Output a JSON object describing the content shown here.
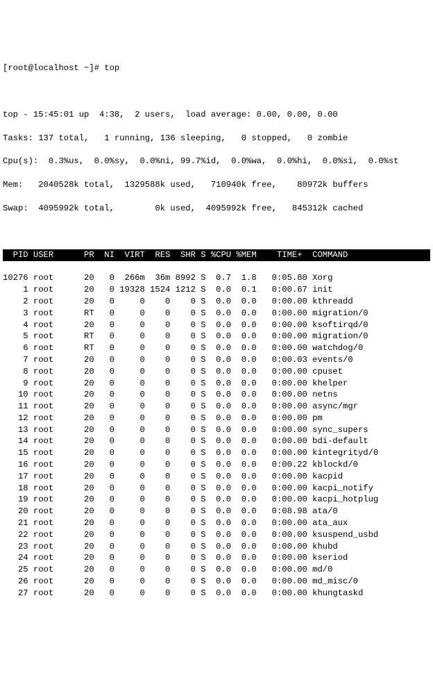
{
  "prompt": "[root@localhost ~]# top",
  "summary": {
    "line1": "top - 15:45:01 up  4:38,  2 users,  load average: 0.00, 0.00, 0.00",
    "line2": "Tasks: 137 total,   1 running, 136 sleeping,   0 stopped,   0 zombie",
    "line3": "Cpu(s):  0.3%us,  0.0%sy,  0.0%ni, 99.7%id,  0.0%wa,  0.0%hi,  0.0%si,  0.0%st",
    "line4": "Mem:   2040528k total,  1329588k used,   710940k free,    80972k buffers",
    "line5": "Swap:  4095992k total,        0k used,  4095992k free,   845312k cached"
  },
  "columns": "  PID USER      PR  NI  VIRT  RES  SHR S %CPU %MEM    TIME+  COMMAND            ",
  "processes": [
    {
      "pid": "10276",
      "user": "root",
      "pr": "20",
      "ni": "0",
      "virt": "266m",
      "res": "36m",
      "shr": "8992",
      "s": "S",
      "cpu": "0.7",
      "mem": "1.8",
      "time": "0:05.80",
      "cmd": "Xorg"
    },
    {
      "pid": "1",
      "user": "root",
      "pr": "20",
      "ni": "0",
      "virt": "19328",
      "res": "1524",
      "shr": "1212",
      "s": "S",
      "cpu": "0.0",
      "mem": "0.1",
      "time": "0:00.67",
      "cmd": "init"
    },
    {
      "pid": "2",
      "user": "root",
      "pr": "20",
      "ni": "0",
      "virt": "0",
      "res": "0",
      "shr": "0",
      "s": "S",
      "cpu": "0.0",
      "mem": "0.0",
      "time": "0:00.00",
      "cmd": "kthreadd"
    },
    {
      "pid": "3",
      "user": "root",
      "pr": "RT",
      "ni": "0",
      "virt": "0",
      "res": "0",
      "shr": "0",
      "s": "S",
      "cpu": "0.0",
      "mem": "0.0",
      "time": "0:00.00",
      "cmd": "migration/0"
    },
    {
      "pid": "4",
      "user": "root",
      "pr": "20",
      "ni": "0",
      "virt": "0",
      "res": "0",
      "shr": "0",
      "s": "S",
      "cpu": "0.0",
      "mem": "0.0",
      "time": "0:00.00",
      "cmd": "ksoftirqd/0"
    },
    {
      "pid": "5",
      "user": "root",
      "pr": "RT",
      "ni": "0",
      "virt": "0",
      "res": "0",
      "shr": "0",
      "s": "S",
      "cpu": "0.0",
      "mem": "0.0",
      "time": "0:00.00",
      "cmd": "migration/0"
    },
    {
      "pid": "6",
      "user": "root",
      "pr": "RT",
      "ni": "0",
      "virt": "0",
      "res": "0",
      "shr": "0",
      "s": "S",
      "cpu": "0.0",
      "mem": "0.0",
      "time": "0:00.00",
      "cmd": "watchdog/0"
    },
    {
      "pid": "7",
      "user": "root",
      "pr": "20",
      "ni": "0",
      "virt": "0",
      "res": "0",
      "shr": "0",
      "s": "S",
      "cpu": "0.0",
      "mem": "0.0",
      "time": "0:00.03",
      "cmd": "events/0"
    },
    {
      "pid": "8",
      "user": "root",
      "pr": "20",
      "ni": "0",
      "virt": "0",
      "res": "0",
      "shr": "0",
      "s": "S",
      "cpu": "0.0",
      "mem": "0.0",
      "time": "0:00.00",
      "cmd": "cpuset"
    },
    {
      "pid": "9",
      "user": "root",
      "pr": "20",
      "ni": "0",
      "virt": "0",
      "res": "0",
      "shr": "0",
      "s": "S",
      "cpu": "0.0",
      "mem": "0.0",
      "time": "0:00.00",
      "cmd": "khelper"
    },
    {
      "pid": "10",
      "user": "root",
      "pr": "20",
      "ni": "0",
      "virt": "0",
      "res": "0",
      "shr": "0",
      "s": "S",
      "cpu": "0.0",
      "mem": "0.0",
      "time": "0:00.00",
      "cmd": "netns"
    },
    {
      "pid": "11",
      "user": "root",
      "pr": "20",
      "ni": "0",
      "virt": "0",
      "res": "0",
      "shr": "0",
      "s": "S",
      "cpu": "0.0",
      "mem": "0.0",
      "time": "0:00.00",
      "cmd": "async/mgr"
    },
    {
      "pid": "12",
      "user": "root",
      "pr": "20",
      "ni": "0",
      "virt": "0",
      "res": "0",
      "shr": "0",
      "s": "S",
      "cpu": "0.0",
      "mem": "0.0",
      "time": "0:00.00",
      "cmd": "pm"
    },
    {
      "pid": "13",
      "user": "root",
      "pr": "20",
      "ni": "0",
      "virt": "0",
      "res": "0",
      "shr": "0",
      "s": "S",
      "cpu": "0.0",
      "mem": "0.0",
      "time": "0:00.00",
      "cmd": "sync_supers"
    },
    {
      "pid": "14",
      "user": "root",
      "pr": "20",
      "ni": "0",
      "virt": "0",
      "res": "0",
      "shr": "0",
      "s": "S",
      "cpu": "0.0",
      "mem": "0.0",
      "time": "0:00.00",
      "cmd": "bdi-default"
    },
    {
      "pid": "15",
      "user": "root",
      "pr": "20",
      "ni": "0",
      "virt": "0",
      "res": "0",
      "shr": "0",
      "s": "S",
      "cpu": "0.0",
      "mem": "0.0",
      "time": "0:00.00",
      "cmd": "kintegrityd/0"
    },
    {
      "pid": "16",
      "user": "root",
      "pr": "20",
      "ni": "0",
      "virt": "0",
      "res": "0",
      "shr": "0",
      "s": "S",
      "cpu": "0.0",
      "mem": "0.0",
      "time": "0:00.22",
      "cmd": "kblockd/0"
    },
    {
      "pid": "17",
      "user": "root",
      "pr": "20",
      "ni": "0",
      "virt": "0",
      "res": "0",
      "shr": "0",
      "s": "S",
      "cpu": "0.0",
      "mem": "0.0",
      "time": "0:00.00",
      "cmd": "kacpid"
    },
    {
      "pid": "18",
      "user": "root",
      "pr": "20",
      "ni": "0",
      "virt": "0",
      "res": "0",
      "shr": "0",
      "s": "S",
      "cpu": "0.0",
      "mem": "0.0",
      "time": "0:00.00",
      "cmd": "kacpi_notify"
    },
    {
      "pid": "19",
      "user": "root",
      "pr": "20",
      "ni": "0",
      "virt": "0",
      "res": "0",
      "shr": "0",
      "s": "S",
      "cpu": "0.0",
      "mem": "0.0",
      "time": "0:00.00",
      "cmd": "kacpi_hotplug"
    },
    {
      "pid": "20",
      "user": "root",
      "pr": "20",
      "ni": "0",
      "virt": "0",
      "res": "0",
      "shr": "0",
      "s": "S",
      "cpu": "0.0",
      "mem": "0.0",
      "time": "0:08.98",
      "cmd": "ata/0"
    },
    {
      "pid": "21",
      "user": "root",
      "pr": "20",
      "ni": "0",
      "virt": "0",
      "res": "0",
      "shr": "0",
      "s": "S",
      "cpu": "0.0",
      "mem": "0.0",
      "time": "0:00.00",
      "cmd": "ata_aux"
    },
    {
      "pid": "22",
      "user": "root",
      "pr": "20",
      "ni": "0",
      "virt": "0",
      "res": "0",
      "shr": "0",
      "s": "S",
      "cpu": "0.0",
      "mem": "0.0",
      "time": "0:00.00",
      "cmd": "ksuspend_usbd"
    },
    {
      "pid": "23",
      "user": "root",
      "pr": "20",
      "ni": "0",
      "virt": "0",
      "res": "0",
      "shr": "0",
      "s": "S",
      "cpu": "0.0",
      "mem": "0.0",
      "time": "0:00.00",
      "cmd": "khubd"
    },
    {
      "pid": "24",
      "user": "root",
      "pr": "20",
      "ni": "0",
      "virt": "0",
      "res": "0",
      "shr": "0",
      "s": "S",
      "cpu": "0.0",
      "mem": "0.0",
      "time": "0:00.00",
      "cmd": "kseriod"
    },
    {
      "pid": "25",
      "user": "root",
      "pr": "20",
      "ni": "0",
      "virt": "0",
      "res": "0",
      "shr": "0",
      "s": "S",
      "cpu": "0.0",
      "mem": "0.0",
      "time": "0:00.00",
      "cmd": "md/0"
    },
    {
      "pid": "26",
      "user": "root",
      "pr": "20",
      "ni": "0",
      "virt": "0",
      "res": "0",
      "shr": "0",
      "s": "S",
      "cpu": "0.0",
      "mem": "0.0",
      "time": "0:00.00",
      "cmd": "md_misc/0"
    },
    {
      "pid": "27",
      "user": "root",
      "pr": "20",
      "ni": "0",
      "virt": "0",
      "res": "0",
      "shr": "0",
      "s": "S",
      "cpu": "0.0",
      "mem": "0.0",
      "time": "0:00.00",
      "cmd": "khungtaskd"
    }
  ]
}
